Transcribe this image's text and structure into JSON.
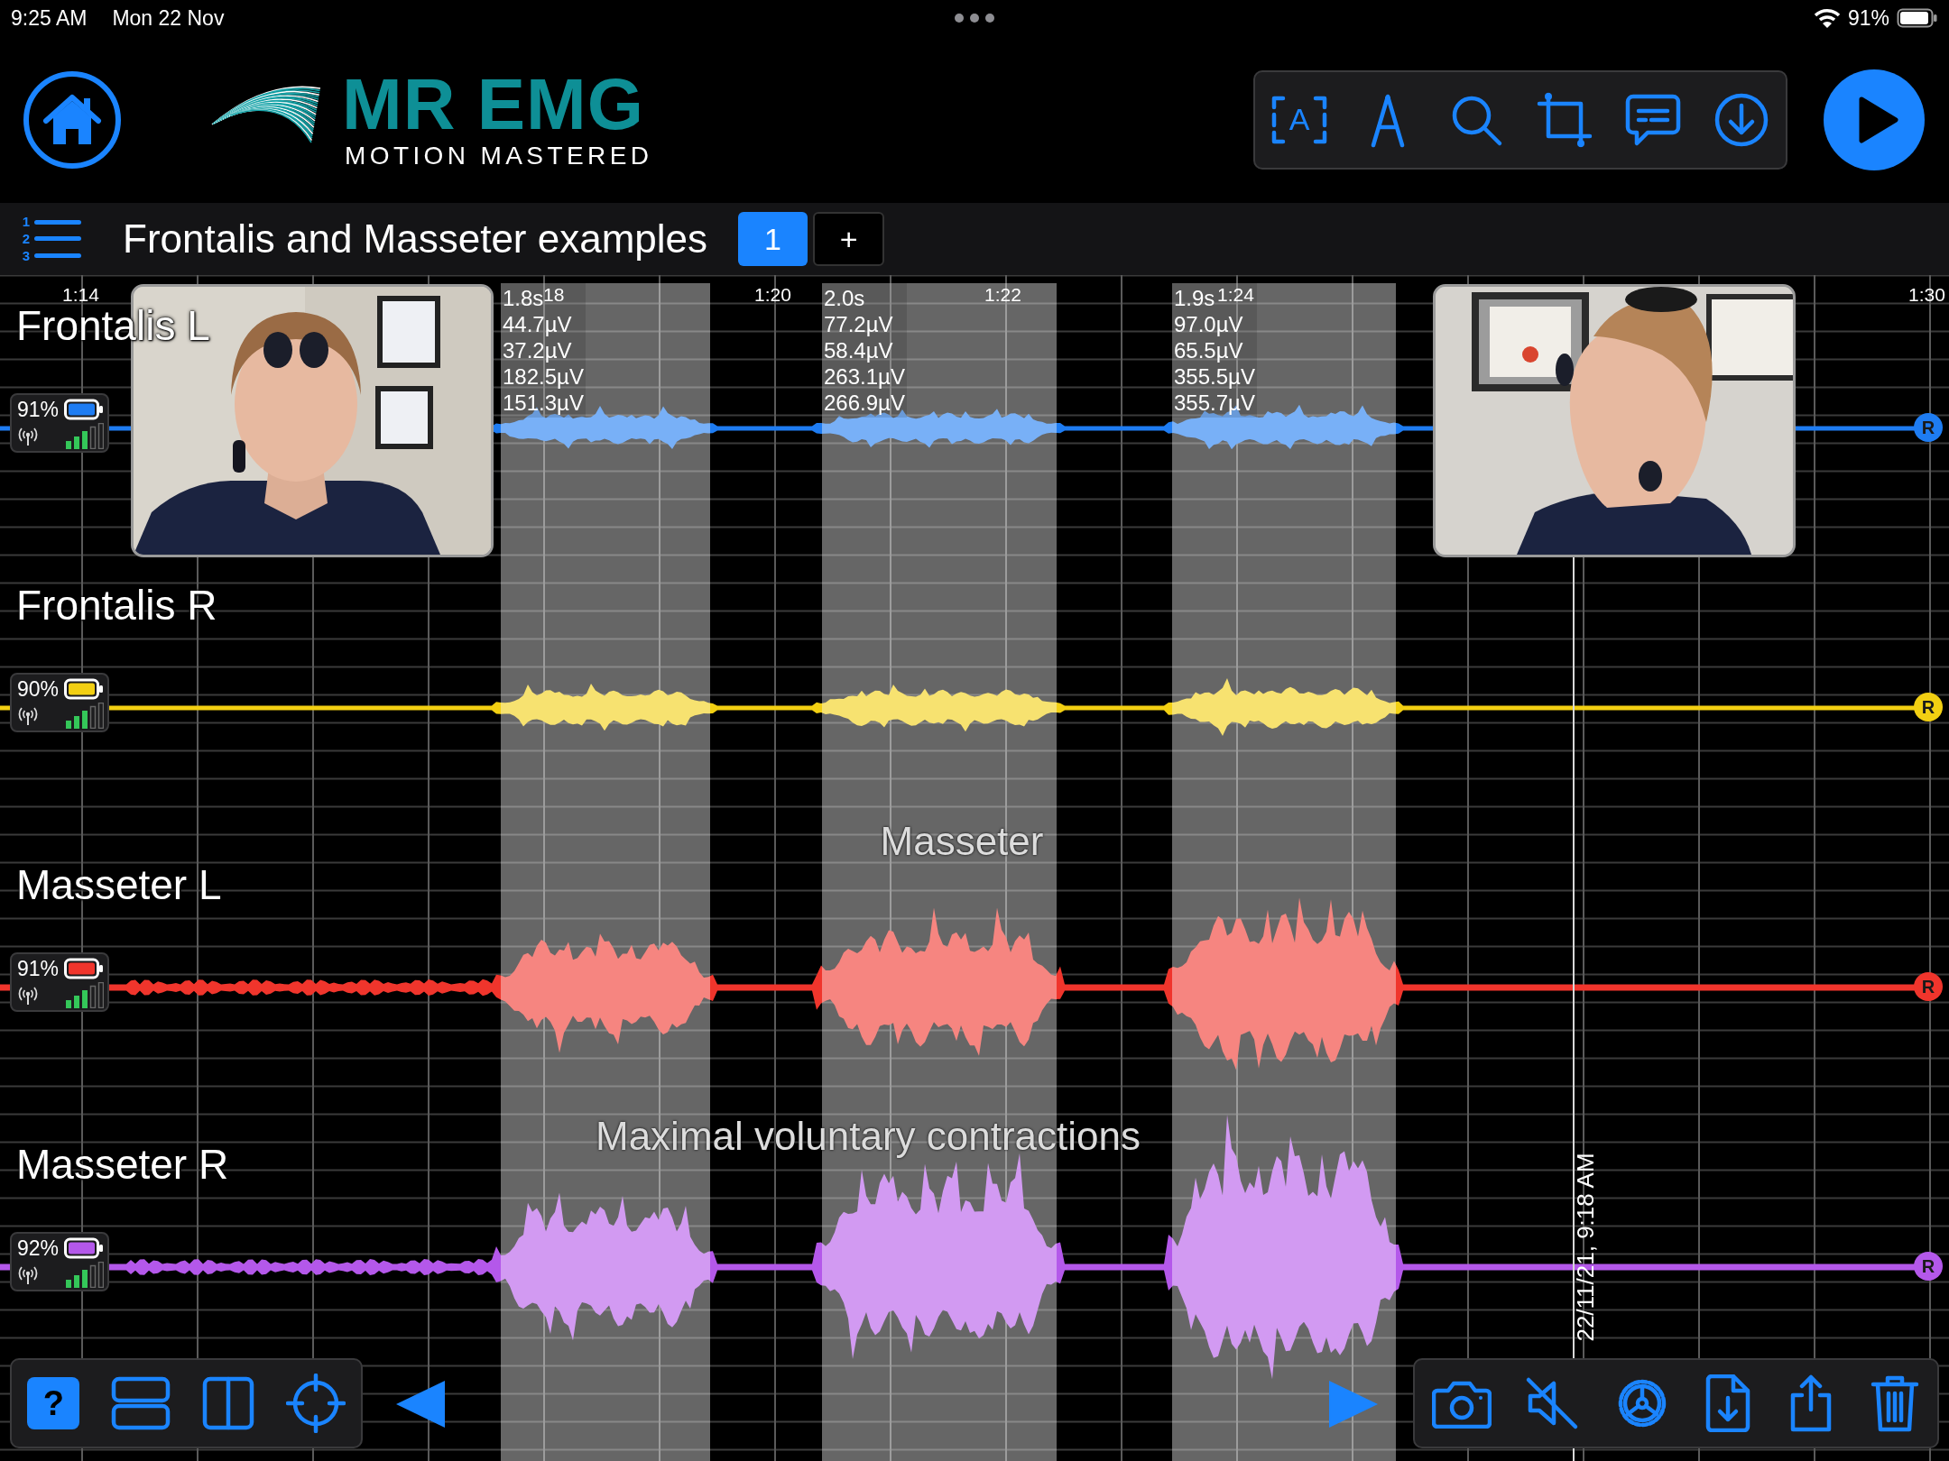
{
  "status_bar": {
    "time": "9:25 AM",
    "date": "Mon 22 Nov",
    "battery": "91%"
  },
  "header": {
    "logo_title": "MR EMG",
    "logo_tagline": "MOTION MASTERED",
    "text_tool_label": "A"
  },
  "session": {
    "list_icon_digits": [
      "1",
      "2",
      "3"
    ],
    "title": "Frontalis and Masseter examples",
    "pages": [
      {
        "label": "1",
        "selected": true
      }
    ],
    "add_button": "+"
  },
  "time_ticks": [
    "1:14",
    "18",
    "1:20",
    "1:22",
    "1:24",
    "1:30"
  ],
  "selections": [
    {
      "duration": "1.8s",
      "readings": [
        "44.7µV",
        "37.2µV",
        "182.5µV",
        "151.3µV"
      ]
    },
    {
      "duration": "2.0s",
      "readings": [
        "77.2µV",
        "58.4µV",
        "263.1µV",
        "266.9µV"
      ]
    },
    {
      "duration": "1.9s",
      "readings": [
        "97.0µV",
        "65.5µV",
        "355.5µV",
        "355.7µV"
      ]
    }
  ],
  "channels": [
    {
      "name": "Frontalis L",
      "battery": "91%",
      "color": "#1e7cf2",
      "marker": "R"
    },
    {
      "name": "Frontalis R",
      "battery": "90%",
      "color": "#f2cf12",
      "marker": "R"
    },
    {
      "name": "Masseter L",
      "battery": "91%",
      "color": "#f0352c",
      "marker": "R"
    },
    {
      "name": "Masseter R",
      "battery": "92%",
      "color": "#b458ea",
      "marker": "R"
    }
  ],
  "annotations": [
    {
      "kind": "label",
      "text": "Masseter"
    },
    {
      "kind": "label",
      "text": "Maximal voluntary contractions"
    },
    {
      "kind": "timestamp",
      "text": "22/11/21, 9:18 AM"
    }
  ],
  "bottom_toolbar": {
    "help_label": "?"
  }
}
